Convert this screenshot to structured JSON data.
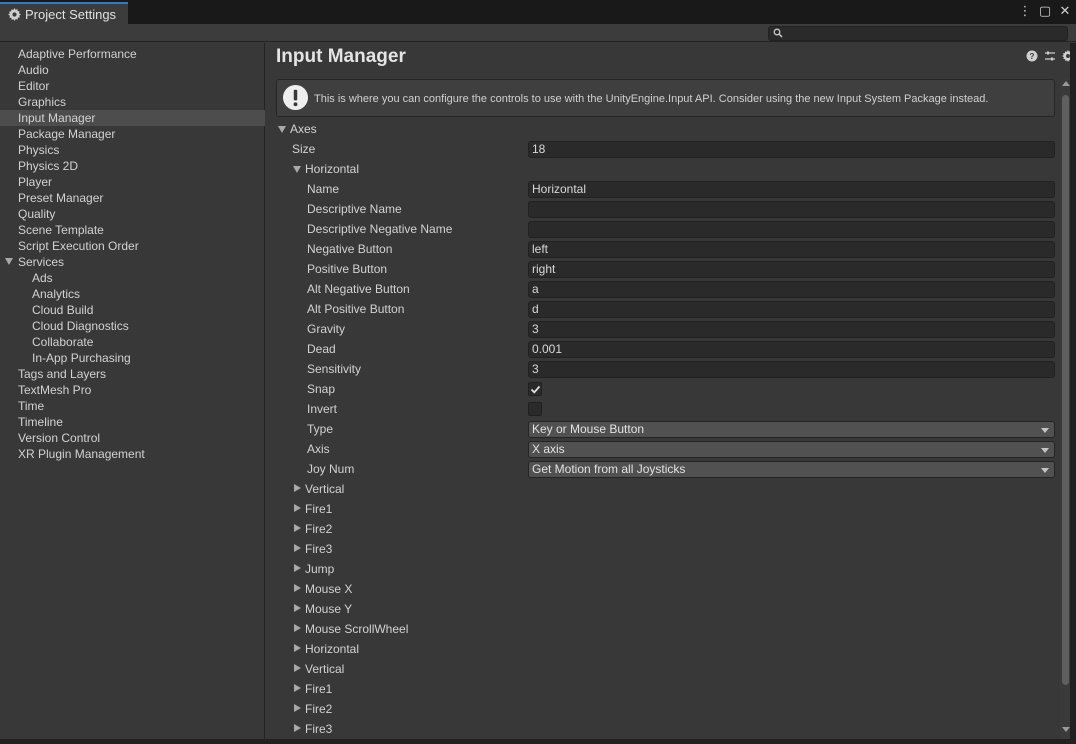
{
  "window": {
    "tab_title": "Project Settings",
    "menu_icon": "kebab-menu-icon",
    "maximize_icon": "maximize-icon",
    "close_icon": "close-icon"
  },
  "search": {
    "placeholder": "",
    "value": ""
  },
  "sidebar": {
    "items": [
      {
        "label": "Adaptive Performance"
      },
      {
        "label": "Audio"
      },
      {
        "label": "Editor"
      },
      {
        "label": "Graphics"
      },
      {
        "label": "Input Manager",
        "selected": true
      },
      {
        "label": "Package Manager"
      },
      {
        "label": "Physics"
      },
      {
        "label": "Physics 2D"
      },
      {
        "label": "Player"
      },
      {
        "label": "Preset Manager"
      },
      {
        "label": "Quality"
      },
      {
        "label": "Scene Template"
      },
      {
        "label": "Script Execution Order"
      },
      {
        "label": "Services",
        "expanded": true
      },
      {
        "label": "Ads",
        "child": true
      },
      {
        "label": "Analytics",
        "child": true
      },
      {
        "label": "Cloud Build",
        "child": true
      },
      {
        "label": "Cloud Diagnostics",
        "child": true
      },
      {
        "label": "Collaborate",
        "child": true
      },
      {
        "label": "In-App Purchasing",
        "child": true
      },
      {
        "label": "Tags and Layers"
      },
      {
        "label": "TextMesh Pro"
      },
      {
        "label": "Time"
      },
      {
        "label": "Timeline"
      },
      {
        "label": "Version Control"
      },
      {
        "label": "XR Plugin Management"
      }
    ]
  },
  "main": {
    "title": "Input Manager",
    "help_message": "This is where you can configure the controls to use with the UnityEngine.Input API. Consider using the new Input System Package instead.",
    "axes_label": "Axes",
    "size_label": "Size",
    "size_value": "18",
    "expanded_axis": "Horizontal",
    "properties": {
      "name": {
        "label": "Name",
        "value": "Horizontal"
      },
      "descriptive_name": {
        "label": "Descriptive Name",
        "value": ""
      },
      "descriptive_negative_name": {
        "label": "Descriptive Negative Name",
        "value": ""
      },
      "negative_button": {
        "label": "Negative Button",
        "value": "left"
      },
      "positive_button": {
        "label": "Positive Button",
        "value": "right"
      },
      "alt_negative_button": {
        "label": "Alt Negative Button",
        "value": "a"
      },
      "alt_positive_button": {
        "label": "Alt Positive Button",
        "value": "d"
      },
      "gravity": {
        "label": "Gravity",
        "value": "3"
      },
      "dead": {
        "label": "Dead",
        "value": "0.001"
      },
      "sensitivity": {
        "label": "Sensitivity",
        "value": "3"
      },
      "snap": {
        "label": "Snap",
        "checked": true
      },
      "invert": {
        "label": "Invert",
        "checked": false
      },
      "type": {
        "label": "Type",
        "value": "Key or Mouse Button"
      },
      "axis": {
        "label": "Axis",
        "value": "X axis"
      },
      "joy_num": {
        "label": "Joy Num",
        "value": "Get Motion from all Joysticks"
      }
    },
    "collapsed_axes": [
      "Vertical",
      "Fire1",
      "Fire2",
      "Fire3",
      "Jump",
      "Mouse X",
      "Mouse Y",
      "Mouse ScrollWheel",
      "Horizontal",
      "Vertical",
      "Fire1",
      "Fire2",
      "Fire3"
    ]
  }
}
